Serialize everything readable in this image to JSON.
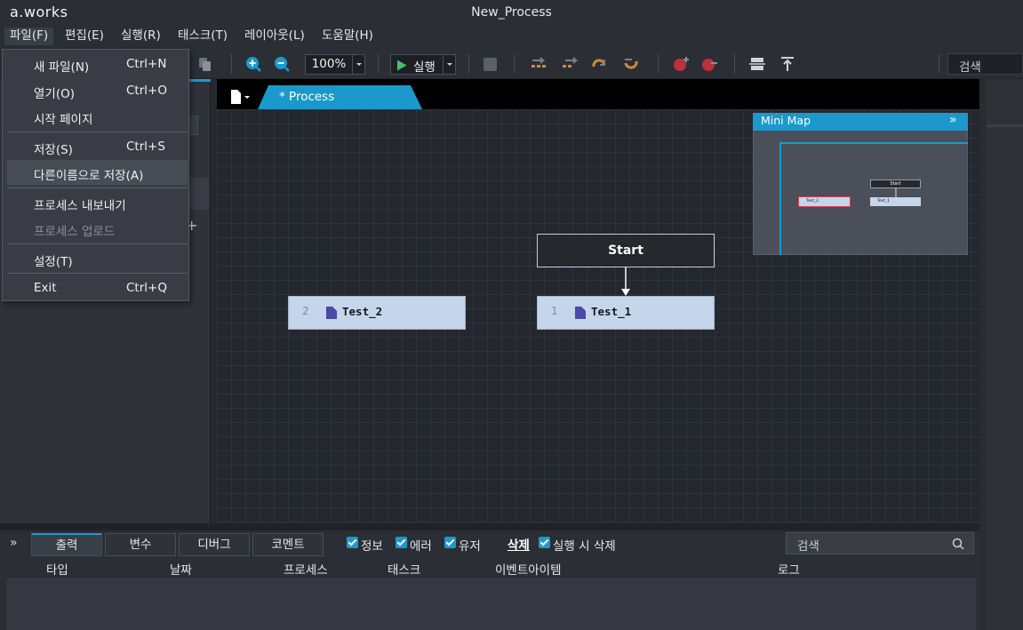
{
  "app": {
    "logo": "a.works",
    "window_title": "New_Process"
  },
  "menubar": [
    {
      "label": "파일(F)"
    },
    {
      "label": "편집(E)"
    },
    {
      "label": "실행(R)"
    },
    {
      "label": "태스크(T)"
    },
    {
      "label": "레이아웃(L)"
    },
    {
      "label": "도움말(H)"
    }
  ],
  "file_menu": {
    "items": [
      {
        "label": "새 파일(N)",
        "shortcut": "Ctrl+N"
      },
      {
        "label": "열기(O)",
        "shortcut": "Ctrl+O"
      },
      {
        "label": "시작 페이지",
        "shortcut": ""
      },
      {
        "label": "저장(S)",
        "shortcut": "Ctrl+S"
      },
      {
        "label": "다른이름으로 저장(A)",
        "shortcut": ""
      },
      {
        "label": "프로세스 내보내기",
        "shortcut": ""
      },
      {
        "label": "프로세스 업로드",
        "shortcut": ""
      },
      {
        "label": "설정(T)",
        "shortcut": ""
      },
      {
        "label": "Exit",
        "shortcut": "Ctrl+Q"
      }
    ]
  },
  "toolbar": {
    "zoom": "100%",
    "run_label": "실행",
    "search_placeholder": "검색"
  },
  "editor": {
    "tab_label": "* Process"
  },
  "diagram": {
    "start_label": "Start",
    "tasks": [
      {
        "number": "1",
        "name": "Test_1"
      },
      {
        "number": "2",
        "name": "Test_2"
      }
    ]
  },
  "minimap": {
    "title": "Mini Map",
    "start_label": "Start",
    "task1_label": "Test_1",
    "task2_label": "Test_2"
  },
  "bottom": {
    "tabs": [
      "출력",
      "변수",
      "디버그",
      "코멘트"
    ],
    "filters": [
      "정보",
      "에러",
      "유저"
    ],
    "delete_label": "삭제",
    "delete_on_run_label": "실행 시 삭제",
    "search_placeholder": "검색",
    "columns": [
      "타입",
      "날짜",
      "프로세스",
      "태스크",
      "이벤트아이템",
      "로그"
    ]
  },
  "colors": {
    "accent": "#1a9ad0",
    "task_fill": "#c5d6ea",
    "background": "#2b2e35"
  }
}
